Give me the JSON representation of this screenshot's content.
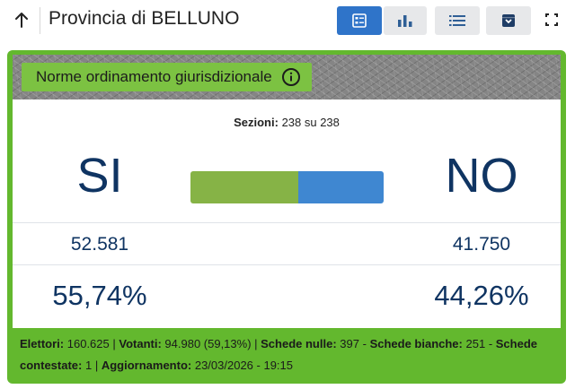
{
  "header": {
    "title": "Provincia di BELLUNO",
    "back_icon": "arrow-up-icon",
    "view_buttons": [
      {
        "name": "summary-view",
        "icon": "summary-card-icon",
        "active": true
      },
      {
        "name": "chart-view",
        "icon": "bar-chart-icon",
        "active": false
      },
      {
        "name": "list-view",
        "icon": "list-icon",
        "active": false
      },
      {
        "name": "archive-view",
        "icon": "archive-box-icon",
        "active": false
      }
    ],
    "fullscreen_icon": "fullscreen-icon"
  },
  "card": {
    "title": "Norme ordinamento giurisdizionale",
    "info_icon": "info-icon",
    "sezioni_label": "Sezioni:",
    "sezioni_value": "238 su 238",
    "yes": {
      "label": "SI",
      "votes": "52.581",
      "percent": "55,74%",
      "share": 0.5574
    },
    "no": {
      "label": "NO",
      "votes": "41.750",
      "percent": "44,26%",
      "share": 0.4426
    },
    "colors": {
      "card_green": "#63b82e",
      "yes_bar": "#86b346",
      "no_bar": "#3f87d1",
      "text_navy": "#0f3462",
      "active_blue": "#2f74c9"
    },
    "footer": {
      "elettori_label": "Elettori:",
      "elettori_value": "160.625",
      "votanti_label": "Votanti:",
      "votanti_value": "94.980 (59,13%)",
      "nulle_label": "Schede nulle:",
      "nulle_value": "397",
      "bianche_label": "Schede bianche:",
      "bianche_value": "251",
      "contestate_label": "Schede contestate:",
      "contestate_value": "1",
      "aggiornamento_label": "Aggiornamento:",
      "aggiornamento_value": "23/03/2026 - 19:15"
    }
  }
}
